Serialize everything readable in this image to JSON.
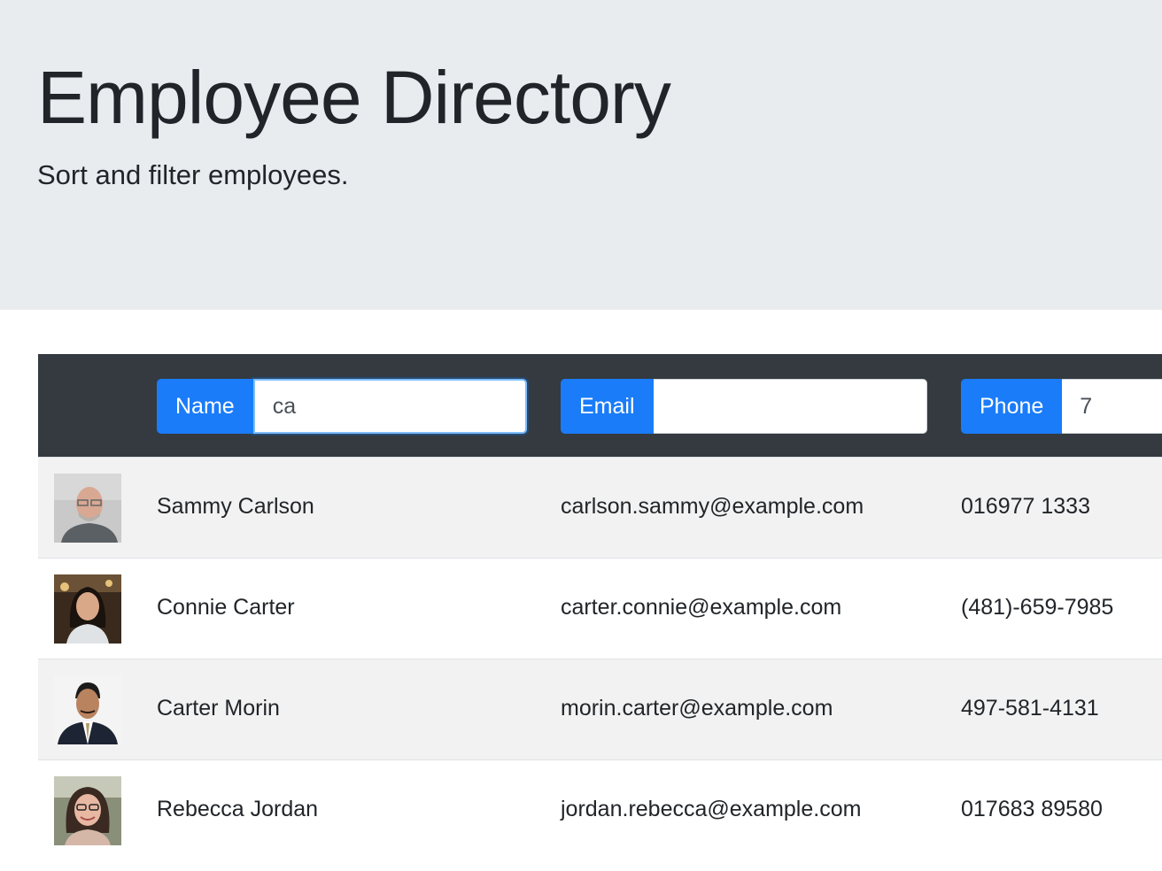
{
  "header": {
    "title": "Employee Directory",
    "subtitle": "Sort and filter employees."
  },
  "filters": {
    "name": {
      "label": "Name",
      "value": "ca",
      "focused": true
    },
    "email": {
      "label": "Email",
      "value": ""
    },
    "phone": {
      "label": "Phone",
      "value": "7"
    }
  },
  "employees": [
    {
      "name": "Sammy Carlson",
      "email": "carlson.sammy@example.com",
      "phone": "016977 1333",
      "avatar": "older-man-with-glasses-photo"
    },
    {
      "name": "Connie Carter",
      "email": "carter.connie@example.com",
      "phone": "(481)-659-7985",
      "avatar": "young-woman-photo"
    },
    {
      "name": "Carter Morin",
      "email": "morin.carter@example.com",
      "phone": "497-581-4131",
      "avatar": "man-in-suit-photo"
    },
    {
      "name": "Rebecca Jordan",
      "email": "jordan.rebecca@example.com",
      "phone": "017683 89580",
      "avatar": "woman-with-glasses-photo"
    }
  ],
  "colors": {
    "jumbotron_bg": "#e9ecef",
    "table_head_bg": "#343a40",
    "primary": "#1a7cf9",
    "striped_row": "#f2f2f2"
  }
}
